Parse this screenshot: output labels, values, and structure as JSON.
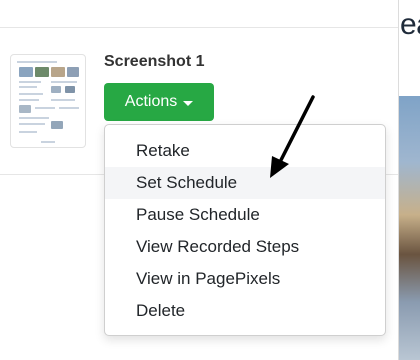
{
  "card": {
    "title": "Screenshot 1",
    "actions_label": "Actions",
    "thumbnail_alt": "screenshot-thumbnail"
  },
  "menu": {
    "items": [
      {
        "label": "Retake"
      },
      {
        "label": "Set Schedule"
      },
      {
        "label": "Pause Schedule"
      },
      {
        "label": "View Recorded Steps"
      },
      {
        "label": "View in PagePixels"
      },
      {
        "label": "Delete"
      }
    ],
    "hovered_item": "Set Schedule"
  },
  "background_page": {
    "heading_fragment": "ea"
  },
  "colors": {
    "accent_green": "#27a844",
    "heading_dark": "#1f2b3a",
    "menu_hover": "#f4f5f7"
  },
  "icons": {
    "caret": "chevron-down-icon",
    "pointer": "arrow-pointer-icon"
  }
}
